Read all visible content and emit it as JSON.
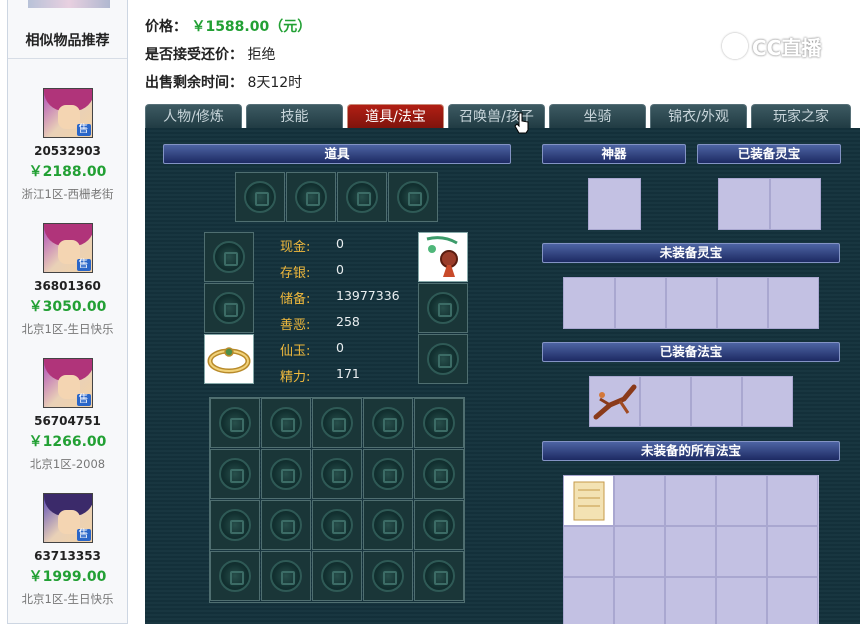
{
  "sidebar": {
    "title": "相似物品推荐",
    "items": [
      {
        "id": "20532903",
        "price": "￥2188.00",
        "server": "浙江1区-西栅老街",
        "badge": "售"
      },
      {
        "id": "36801360",
        "price": "￥3050.00",
        "server": "北京1区-生日快乐",
        "badge": "售"
      },
      {
        "id": "56704751",
        "price": "￥1266.00",
        "server": "北京1区-2008",
        "badge": "售"
      },
      {
        "id": "63713353",
        "price": "￥1999.00",
        "server": "北京1区-生日快乐",
        "badge": "售"
      }
    ]
  },
  "info": {
    "price_label": "价格：",
    "price_value": "￥1588.00（元）",
    "counter_label": "是否接受还价：",
    "counter_value": "拒绝",
    "time_label": "出售剩余时间：",
    "time_value": "8天12时"
  },
  "watermark": "CC直播",
  "tabs": [
    "人物/修炼",
    "技能",
    "道具/法宝",
    "召唤兽/孩子",
    "坐骑",
    "锦衣/外观",
    "玩家之家"
  ],
  "active_tab": "道具/法宝",
  "sections": {
    "items": "道具",
    "artifact": "神器",
    "equipped_lingbao": "已装备灵宝",
    "unequipped_lingbao": "未装备灵宝",
    "equipped_fabao": "已装备法宝",
    "all_unequipped_fabao": "未装备的所有法宝"
  },
  "stats": [
    {
      "label": "现金:",
      "value": "0"
    },
    {
      "label": "存银:",
      "value": "0"
    },
    {
      "label": "储备:",
      "value": "13977336"
    },
    {
      "label": "善恶:",
      "value": "258"
    },
    {
      "label": "仙玉:",
      "value": "0"
    },
    {
      "label": "精力:",
      "value": "171"
    }
  ]
}
